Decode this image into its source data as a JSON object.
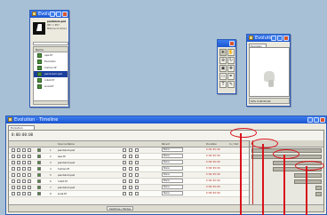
{
  "project_window": {
    "title": "Evolution",
    "file_info_name": "pendulum.psd",
    "file_info_line1": "967 × 957",
    "file_info_line2": "Millions of Colors",
    "column_name": "Name",
    "items": [
      {
        "label": "ape.tif"
      },
      {
        "label": "Evolution"
      },
      {
        "label": "human.tif"
      },
      {
        "label": "pendulum.psd",
        "selected": true
      },
      {
        "label": "robot.tif"
      },
      {
        "label": "snail.tif"
      }
    ]
  },
  "comp_window": {
    "title": "Evolution",
    "tab_label": "Evolution",
    "footer": "50%  0:00:00:00"
  },
  "timeline_window": {
    "title": "Evolution · Timeline",
    "tab_label": "Evolution",
    "timecode": "0:00:00:00",
    "columns": [
      "Source Name",
      "Parent",
      "Duration",
      "In / Out"
    ],
    "layers": [
      {
        "num": "1",
        "name": "pendulum.psd",
        "parent": "None",
        "duration": "0:00:05:00"
      },
      {
        "num": "2",
        "name": "ape.tif",
        "parent": "None",
        "duration": "0:00:05:00"
      },
      {
        "num": "3",
        "name": "pendulum.psd",
        "parent": "None",
        "duration": "0:00:05:00"
      },
      {
        "num": "4",
        "name": "human.tif",
        "parent": "None",
        "duration": "0:00:05:00"
      },
      {
        "num": "5",
        "name": "pendulum.psd",
        "parent": "None",
        "duration": "0:00:05:00"
      },
      {
        "num": "6",
        "name": "robot.tif",
        "parent": "None",
        "duration": "0:00:05:00"
      },
      {
        "num": "7",
        "name": "pendulum.psd",
        "parent": "None",
        "duration": "0:00:05:00"
      },
      {
        "num": "8",
        "name": "snail.tif",
        "parent": "None",
        "duration": "0:00:05:00"
      }
    ],
    "bottom_buttons": [
      "Switches / Modes"
    ]
  },
  "colors": {
    "desktop": "#a7c0d5",
    "titlebar": "#1b55cf",
    "highlight": "#d9121a"
  }
}
